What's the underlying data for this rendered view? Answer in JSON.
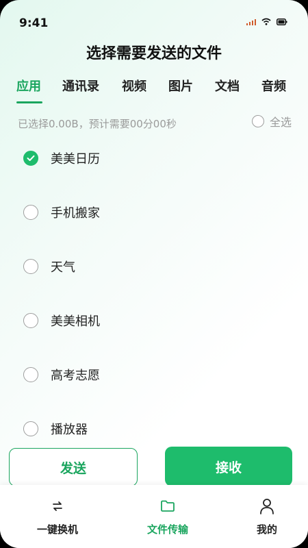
{
  "status_bar": {
    "time": "9:41"
  },
  "page_title": "选择需要发送的文件",
  "tabs": [
    {
      "label": "应用",
      "active": true
    },
    {
      "label": "通讯录",
      "active": false
    },
    {
      "label": "视频",
      "active": false
    },
    {
      "label": "图片",
      "active": false
    },
    {
      "label": "文档",
      "active": false
    },
    {
      "label": "音频",
      "active": false
    }
  ],
  "summary_text": "已选择0.00B，预计需要00分00秒",
  "select_all_label": "全选",
  "apps": [
    {
      "name": "美美日历",
      "checked": true
    },
    {
      "name": "手机搬家",
      "checked": false
    },
    {
      "name": "天气",
      "checked": false
    },
    {
      "name": "美美相机",
      "checked": false
    },
    {
      "name": "高考志愿",
      "checked": false
    },
    {
      "name": "播放器",
      "checked": false
    }
  ],
  "actions": {
    "send_label": "发送",
    "receive_label": "接收"
  },
  "bottom_nav": [
    {
      "label": "一键换机",
      "icon": "swap-arrows-icon",
      "active": false
    },
    {
      "label": "文件传输",
      "icon": "folder-icon",
      "active": true
    },
    {
      "label": "我的",
      "icon": "person-icon",
      "active": false
    }
  ],
  "colors": {
    "accent": "#1aa55e",
    "button_fill": "#1ebc6c"
  }
}
